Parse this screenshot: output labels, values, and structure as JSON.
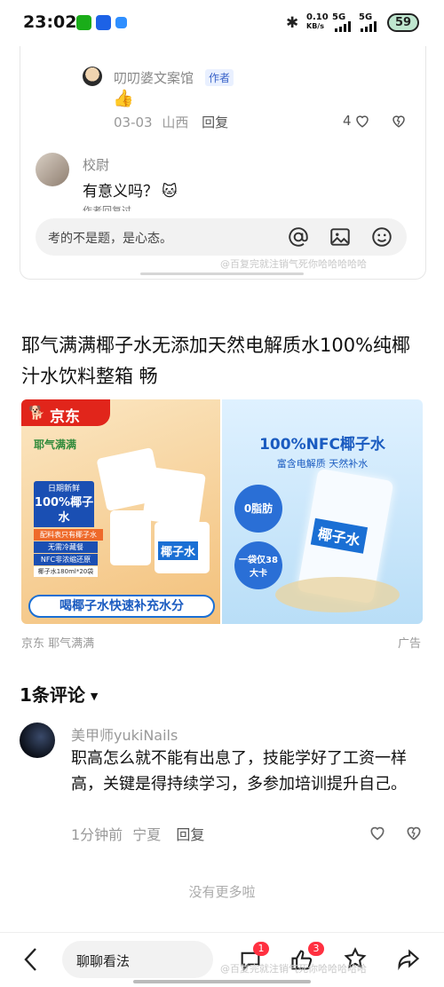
{
  "status_bar": {
    "time": "23:02",
    "net_speed_top": "0.10",
    "net_speed_unit": "KB/s",
    "sig1": "5G",
    "sig2": "5G",
    "battery": "59"
  },
  "reply_thread": {
    "author_reply": {
      "name": "叨叨婆文案馆",
      "tag": "作者",
      "emoji": "👍",
      "date": "03-03",
      "location": "山西",
      "reply_label": "回复",
      "likes": "4"
    },
    "comment": {
      "name": "校尉",
      "text": "有意义吗？",
      "emoji": "🐱",
      "partial_line": "作者回复过"
    },
    "input_placeholder": "考的不是题，是心态。",
    "watermark": "@百复完就注销气死你哈哈哈哈哈"
  },
  "ad": {
    "title": "耶气满满椰子水无添加天然电解质水100%纯椰汁水饮料整箱 畅",
    "image": {
      "jd_label": "京东",
      "brand": "耶气满满",
      "left_tag1": "日期新鲜",
      "left_big": "100%椰子水",
      "left_tag2": "配料表只有椰子水",
      "left_tag3": "无需冷藏餐",
      "left_tag4": "NFC非浓缩还原",
      "left_tag5": "椰子水180ml*20袋",
      "pack_text": "椰子水",
      "slogan": "喝椰子水快速补充水分",
      "right_headline": "100%NFC椰子水",
      "right_sub": "富含电解质  天然补水",
      "bubble1": "0脂肪",
      "bubble2": "一袋仅38大卡",
      "bag_text": "椰子水"
    },
    "source": "京东 耶气满满",
    "label": "广告"
  },
  "comments": {
    "count_title": "1条评论",
    "items": [
      {
        "name": "美甲师yukiNails",
        "text": "职高怎么就不能有出息了，技能学好了工资一样高，关键是得持续学习，多参加培训提升自己。",
        "time": "1分钟前",
        "location": "宁夏",
        "reply_label": "回复"
      }
    ],
    "no_more": "没有更多啦"
  },
  "bottom_bar": {
    "input_label": "聊聊看法",
    "comment_badge": "1",
    "like_badge": "3",
    "watermark": "@百复完就注销气死你哈哈哈哈哈"
  },
  "colors": {
    "jd_red": "#e1251b",
    "badge_red": "#ff3040",
    "author_tag_bg": "#e9f0ff"
  }
}
